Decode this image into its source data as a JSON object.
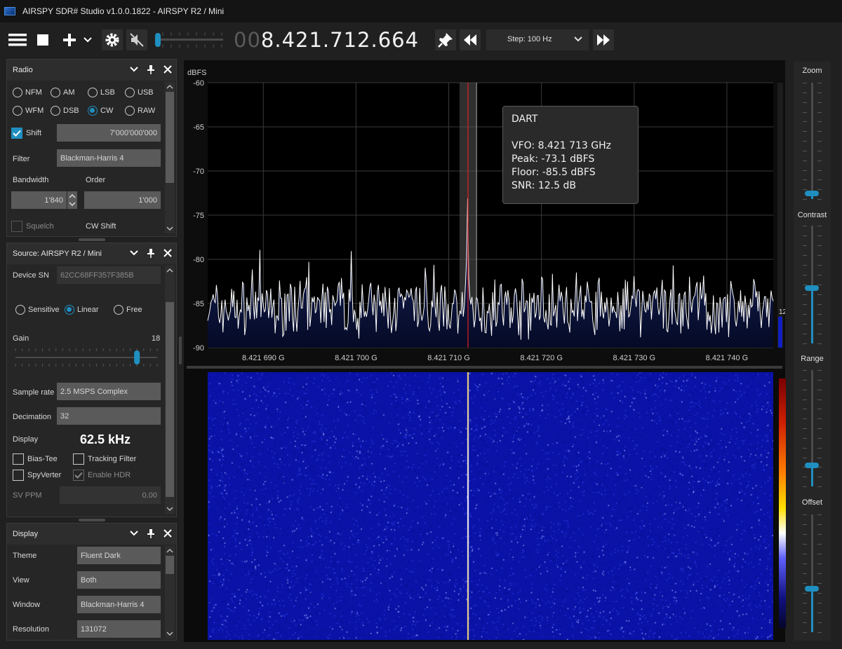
{
  "window": {
    "title": "AIRSPY SDR# Studio v1.0.0.1822 - AIRSPY R2 / Mini"
  },
  "toolbar": {
    "frequency_dim": "00",
    "frequency": "8.421.712.664",
    "step_label": "Step: 100 Hz"
  },
  "radio": {
    "title": "Radio",
    "modes": [
      "NFM",
      "AM",
      "LSB",
      "USB",
      "WFM",
      "DSB",
      "CW",
      "RAW"
    ],
    "selected_mode": "CW",
    "shift_label": "Shift",
    "shift_value": "7'000'000'000",
    "filter_label": "Filter",
    "filter_value": "Blackman-Harris 4",
    "bandwidth_label": "Bandwidth",
    "bandwidth_value": "1'840",
    "order_label": "Order",
    "order_value": "1'000",
    "squelch_label": "Squelch",
    "cw_shift_label": "CW Shift"
  },
  "source": {
    "title": "Source: AIRSPY R2 / Mini",
    "device_sn_label": "Device SN",
    "device_sn_value": "62CC68FF357F385B",
    "modes": [
      "Sensitive",
      "Linear",
      "Free"
    ],
    "selected_mode": "Linear",
    "gain_label": "Gain",
    "gain_value": "18",
    "gain_level": 18,
    "gain_max": 21,
    "sample_rate_label": "Sample rate",
    "sample_rate_value": "2.5 MSPS Complex",
    "decimation_label": "Decimation",
    "decimation_value": "32",
    "display_label": "Display",
    "display_value": "62.5 kHz",
    "bias_tee_label": "Bias-Tee",
    "tracking_filter_label": "Tracking Filter",
    "spyverter_label": "SpyVerter",
    "enable_hdr_label": "Enable HDR",
    "sv_ppm_label": "SV PPM",
    "sv_ppm_value": "0.00"
  },
  "display": {
    "title": "Display",
    "theme_label": "Theme",
    "theme_value": "Fluent Dark",
    "view_label": "View",
    "view_value": "Both",
    "window_label": "Window",
    "window_value": "Blackman-Harris 4",
    "resolution_label": "Resolution",
    "resolution_value": "131072"
  },
  "chart_data": {
    "type": "line",
    "ylabel": "dBFS",
    "ylim": [
      -90,
      -60
    ],
    "yticks": [
      "-60",
      "-65",
      "-70",
      "-75",
      "-80",
      "-85",
      "-90"
    ],
    "xlim": [
      8.421684,
      8.421745
    ],
    "xticks": [
      "8.421 690 G",
      "8.421 700 G",
      "8.421 710 G",
      "8.421 720 G",
      "8.421 730 G",
      "8.421 740 G"
    ],
    "noise_floor_dbfs": -85.5,
    "peak": {
      "frequency_ghz": 8.421712,
      "dbfs": -73.1
    },
    "vfo_ghz": 8.421713,
    "filter_bandwidth_hz": 1840,
    "level_indicator": "12",
    "grid": true
  },
  "tooltip": {
    "name": "DART",
    "vfo": "VFO:  8.421 713 GHz",
    "peak": "Peak:  -73.1 dBFS",
    "floor": "Floor:  -85.5 dBFS",
    "snr": "SNR:  12.5 dB"
  },
  "sliders": {
    "zoom_label": "Zoom",
    "zoom_level": 0.05,
    "contrast_label": "Contrast",
    "contrast_level": 0.47,
    "range_label": "Range",
    "range_level": 0.18,
    "offset_label": "Offset",
    "offset_level": 0.37
  },
  "colors": {
    "accent": "#1f8fc0",
    "vfo_line": "#e02020",
    "trace": "#ffffff",
    "waterfall_bg": "#0a12a0"
  }
}
